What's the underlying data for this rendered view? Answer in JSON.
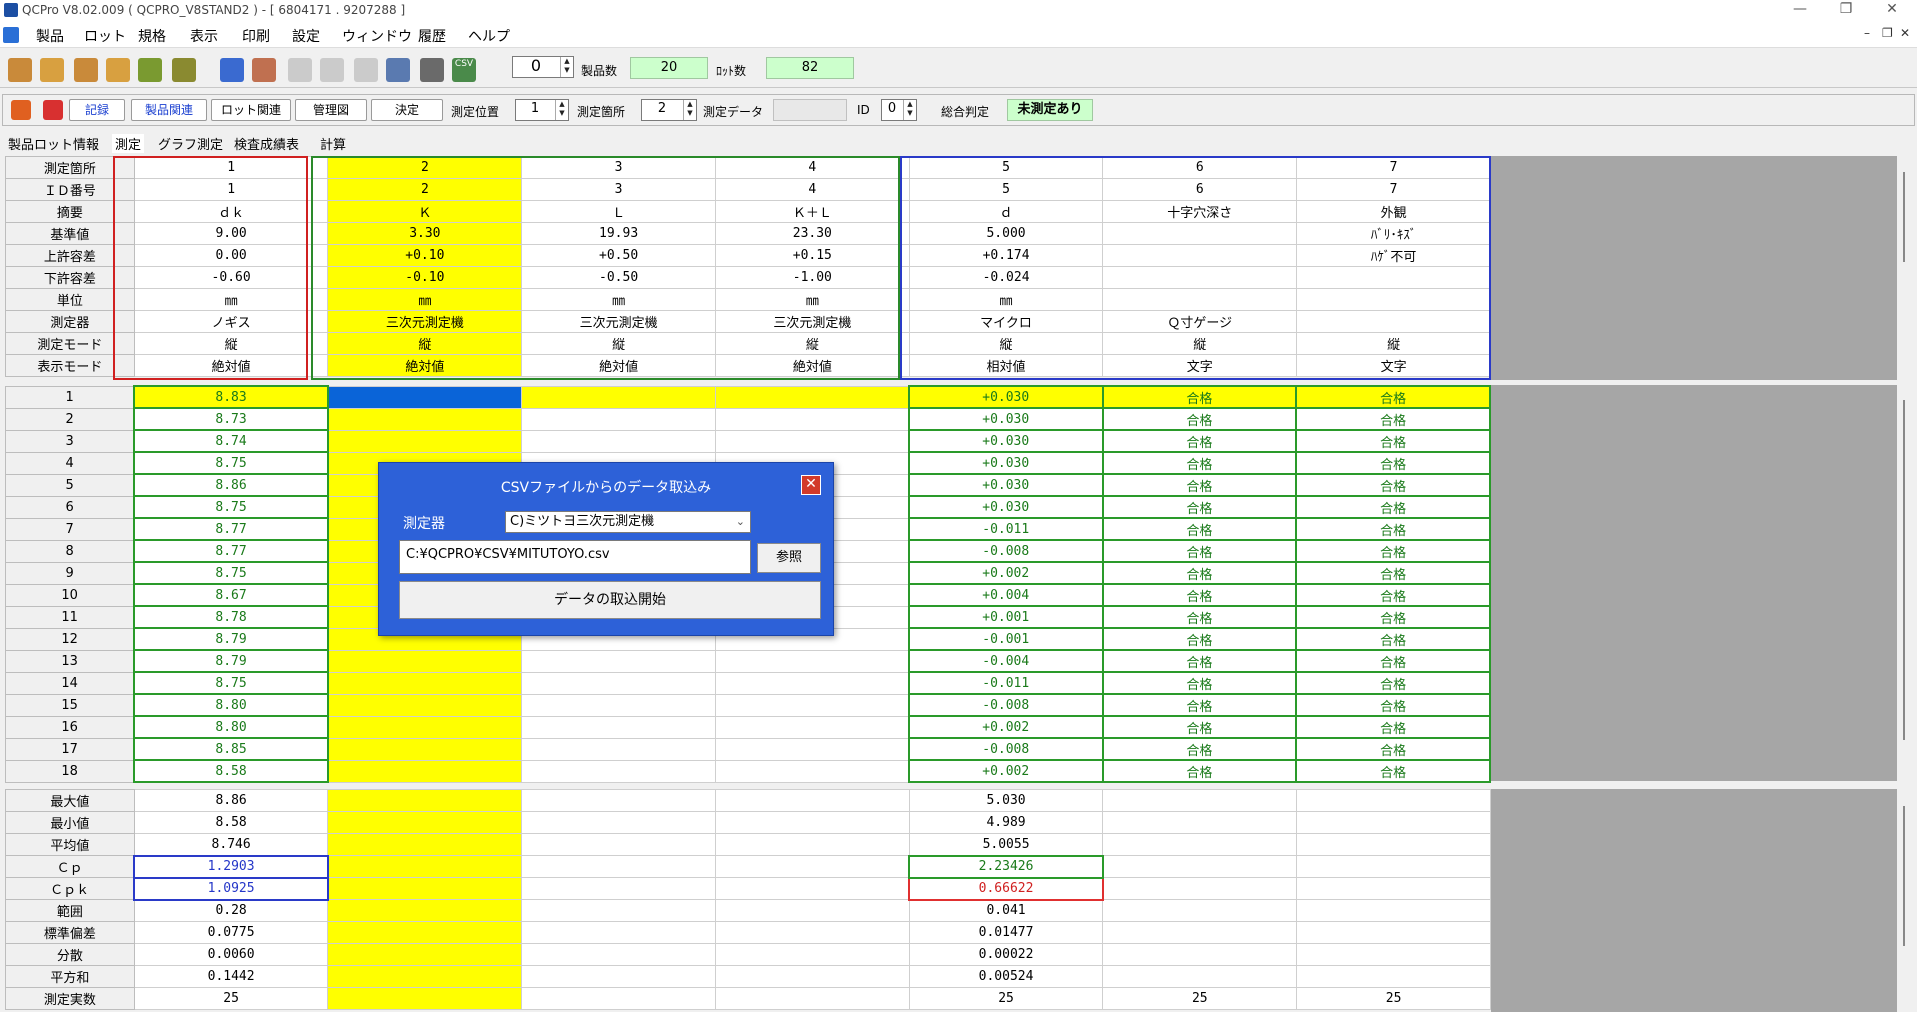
{
  "window": {
    "title": "QCPro V8.02.009 ( QCPRO_V8STAND2 )  - [ 6804171 . 9207288 ]"
  },
  "menu": [
    "製品",
    "ロット",
    "規格",
    "表示",
    "印刷",
    "設定",
    "ウィンドウ",
    "履歴",
    "ヘルプ"
  ],
  "toolbar": {
    "counter_value": "0",
    "product_count_label": "製品数",
    "product_count": "20",
    "lot_count_label": "ﾛｯﾄ数",
    "lot_count": "82",
    "csv_icon_label": "CSV"
  },
  "toolbar2": {
    "record": "記録",
    "product_related": "製品関連",
    "lot_related": "ロット関連",
    "control_chart": "管理図",
    "decide": "決定",
    "measure_position_label": "測定位置",
    "measure_position": "1",
    "measure_point_label": "測定箇所",
    "measure_point": "2",
    "measure_data_label": "測定データ",
    "measure_data": "",
    "id_label": "ID",
    "id_value": "0",
    "overall_label": "総合判定",
    "overall_value": "未測定あり"
  },
  "tabs": [
    "製品ロット情報",
    "測定",
    "グラフ測定",
    "検査成績表",
    "計算"
  ],
  "header_rows": [
    {
      "label": "測定箇所",
      "cells": [
        "1",
        "2",
        "3",
        "4",
        "5",
        "6",
        "7"
      ]
    },
    {
      "label": "ＩＤ番号",
      "cells": [
        "1",
        "2",
        "3",
        "4",
        "5",
        "6",
        "7"
      ]
    },
    {
      "label": "摘要",
      "cells": [
        "ｄｋ",
        "Ｋ",
        "Ｌ",
        "Ｋ＋Ｌ",
        "ｄ",
        "十字穴深さ",
        "外観"
      ]
    },
    {
      "label": "基準値",
      "cells": [
        "9.00",
        "3.30",
        "19.93",
        "23.30",
        "5.000",
        "",
        "ﾊﾞﾘ･ｷｽﾞ"
      ]
    },
    {
      "label": "上許容差",
      "cells": [
        "0.00",
        "+0.10",
        "+0.50",
        "+0.15",
        "+0.174",
        "",
        "ﾊｹﾞ不可"
      ]
    },
    {
      "label": "下許容差",
      "cells": [
        "-0.60",
        "-0.10",
        "-0.50",
        "-1.00",
        "-0.024",
        "",
        ""
      ]
    },
    {
      "label": "単位",
      "cells": [
        "㎜",
        "㎜",
        "㎜",
        "㎜",
        "㎜",
        "",
        ""
      ]
    },
    {
      "label": "測定器",
      "cells": [
        "ノギス",
        "三次元測定機",
        "三次元測定機",
        "三次元測定機",
        "マイクロ",
        "Ｑ寸ゲージ",
        ""
      ]
    },
    {
      "label": "測定モード",
      "cells": [
        "縦",
        "縦",
        "縦",
        "縦",
        "縦",
        "縦",
        "縦"
      ]
    },
    {
      "label": "表示モード",
      "cells": [
        "絶対値",
        "絶対値",
        "絶対値",
        "絶対値",
        "相対値",
        "文字",
        "文字"
      ]
    }
  ],
  "data_rows": [
    {
      "no": "1",
      "c1": "8.83",
      "c5": "+0.030",
      "c6": "合格",
      "c7": "合格"
    },
    {
      "no": "2",
      "c1": "8.73",
      "c5": "+0.030",
      "c6": "合格",
      "c7": "合格"
    },
    {
      "no": "3",
      "c1": "8.74",
      "c5": "+0.030",
      "c6": "合格",
      "c7": "合格"
    },
    {
      "no": "4",
      "c1": "8.75",
      "c5": "+0.030",
      "c6": "合格",
      "c7": "合格"
    },
    {
      "no": "5",
      "c1": "8.86",
      "c5": "+0.030",
      "c6": "合格",
      "c7": "合格"
    },
    {
      "no": "6",
      "c1": "8.75",
      "c5": "+0.030",
      "c6": "合格",
      "c7": "合格"
    },
    {
      "no": "7",
      "c1": "8.77",
      "c5": "-0.011",
      "c6": "合格",
      "c7": "合格"
    },
    {
      "no": "8",
      "c1": "8.77",
      "c5": "-0.008",
      "c6": "合格",
      "c7": "合格"
    },
    {
      "no": "9",
      "c1": "8.75",
      "c5": "+0.002",
      "c6": "合格",
      "c7": "合格"
    },
    {
      "no": "10",
      "c1": "8.67",
      "c5": "+0.004",
      "c6": "合格",
      "c7": "合格"
    },
    {
      "no": "11",
      "c1": "8.78",
      "c5": "+0.001",
      "c6": "合格",
      "c7": "合格"
    },
    {
      "no": "12",
      "c1": "8.79",
      "c5": "-0.001",
      "c6": "合格",
      "c7": "合格"
    },
    {
      "no": "13",
      "c1": "8.79",
      "c5": "-0.004",
      "c6": "合格",
      "c7": "合格"
    },
    {
      "no": "14",
      "c1": "8.75",
      "c5": "-0.011",
      "c6": "合格",
      "c7": "合格"
    },
    {
      "no": "15",
      "c1": "8.80",
      "c5": "-0.008",
      "c6": "合格",
      "c7": "合格"
    },
    {
      "no": "16",
      "c1": "8.80",
      "c5": "+0.002",
      "c6": "合格",
      "c7": "合格"
    },
    {
      "no": "17",
      "c1": "8.85",
      "c5": "-0.008",
      "c6": "合格",
      "c7": "合格"
    },
    {
      "no": "18",
      "c1": "8.58",
      "c5": "+0.002",
      "c6": "合格",
      "c7": "合格"
    }
  ],
  "stats_rows": [
    {
      "label": "最大値",
      "c1": "8.86",
      "c5": "5.030",
      "c6": "",
      "c7": ""
    },
    {
      "label": "最小値",
      "c1": "8.58",
      "c5": "4.989",
      "c6": "",
      "c7": ""
    },
    {
      "label": "平均値",
      "c1": "8.746",
      "c5": "5.0055",
      "c6": "",
      "c7": ""
    },
    {
      "label": "Ｃｐ",
      "c1": "1.2903",
      "c5": "2.23426",
      "c6": "",
      "c7": ""
    },
    {
      "label": "Ｃｐｋ",
      "c1": "1.0925",
      "c5": "0.66622",
      "c6": "",
      "c7": ""
    },
    {
      "label": "範囲",
      "c1": "0.28",
      "c5": "0.041",
      "c6": "",
      "c7": ""
    },
    {
      "label": "標準偏差",
      "c1": "0.0775",
      "c5": "0.01477",
      "c6": "",
      "c7": ""
    },
    {
      "label": "分散",
      "c1": "0.0060",
      "c5": "0.00022",
      "c6": "",
      "c7": ""
    },
    {
      "label": "平方和",
      "c1": "0.1442",
      "c5": "0.00524",
      "c6": "",
      "c7": ""
    },
    {
      "label": "測定実数",
      "c1": "25",
      "c5": "25",
      "c6": "25",
      "c7": "25"
    }
  ],
  "dialog": {
    "title": "CSVファイルからのデータ取込み",
    "device_label": "測定器",
    "device_value": "C)ミツトヨ三次元測定機",
    "path": "C:¥QCPRO¥CSV¥MITUTOYO.csv",
    "browse": "参照",
    "start": "データの取込開始",
    "close_icon": "close-icon"
  },
  "colors": {
    "highlight_yellow": "#ffff00",
    "pass_green": "#1a7a1a",
    "dialog_blue": "#2d61d8",
    "status_green": "#ccffcc"
  }
}
